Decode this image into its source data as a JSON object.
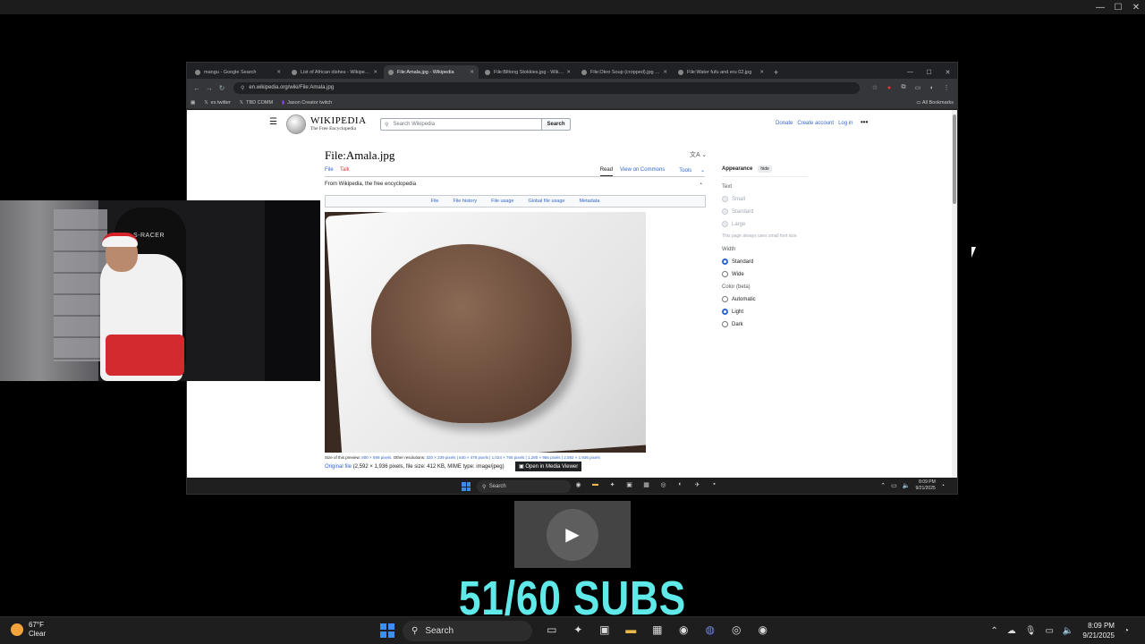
{
  "outer": {
    "win_controls": [
      "—",
      "☐",
      "✕"
    ]
  },
  "browser": {
    "tabs": [
      {
        "label": "mangu - Google Search",
        "active": false
      },
      {
        "label": "List of African dishes - Wikipedia",
        "active": false
      },
      {
        "label": "File:Amala.jpg - Wikipedia",
        "active": true
      },
      {
        "label": "File:Biltong Stokkies.jpg - Wikipedia",
        "active": false
      },
      {
        "label": "File:Okro Soup (cropped).jpg - Wikipedia",
        "active": false
      },
      {
        "label": "File:Water fufu and eru 02.jpg",
        "active": false
      }
    ],
    "new_tab": "+",
    "win_controls": [
      "—",
      "☐",
      "✕"
    ],
    "url": "en.wikipedia.org/wiki/File:Amala.jpg",
    "bookmarks": [
      {
        "label": "es twitter",
        "icon": "𝕏"
      },
      {
        "label": "TBD COMM",
        "icon": "𝕏"
      },
      {
        "label": "Jason Creator twitch",
        "icon": "▮"
      }
    ],
    "all_bookmarks": "All Bookmarks"
  },
  "wiki": {
    "logo_word": "WIKIPEDIA",
    "logo_tagline": "The Free Encyclopedia",
    "search_placeholder": "Search Wikipedia",
    "search_button": "Search",
    "header_links": [
      "Donate",
      "Create account",
      "Log in"
    ],
    "title": "File:Amala.jpg",
    "tab_file": "File",
    "tab_talk": "Talk",
    "tab_read": "Read",
    "tab_commons": "View on Commons",
    "tab_tools": "Tools",
    "from": "From Wikipedia, the free encyclopedia",
    "file_tabs": [
      "File",
      "File history",
      "File usage",
      "Global file usage",
      "Metadata"
    ],
    "size_preview_label": "Size of this preview:",
    "size_preview_value": "800 × 598 pixels",
    "other_res_label": ". Other resolutions:",
    "other_res_values": "320 × 239 pixels | 640 × 478 pixels | 1,024 × 765 pixels | 1,280 × 956 pixels | 2,592 × 1,936 pixels",
    "original_link": "Original file",
    "original_info": "(2,592 × 1,936 pixels, file size: 412 KB, MIME type: image/jpeg)",
    "media_viewer": "Open in Media Viewer",
    "appearance": {
      "title": "Appearance",
      "hide": "hide",
      "text_label": "Text",
      "text_options": [
        "Small",
        "Standard",
        "Large"
      ],
      "text_note": "This page always uses small font size",
      "width_label": "Width",
      "width_options": [
        "Standard",
        "Wide"
      ],
      "color_label": "Color (beta)",
      "color_options": [
        "Automatic",
        "Light",
        "Dark"
      ]
    }
  },
  "inner_taskbar": {
    "search": "Search",
    "time": "8:09 PM",
    "date": "9/21/2025"
  },
  "webcam": {
    "chair_text": "S-RACER"
  },
  "overlay": {
    "subs": "51/60 SUBS"
  },
  "taskbar": {
    "weather_temp": "67°F",
    "weather_desc": "Clear",
    "search": "Search",
    "time": "8:09 PM",
    "date": "9/21/2025"
  }
}
